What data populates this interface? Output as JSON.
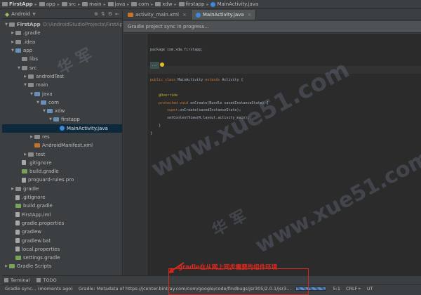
{
  "breadcrumbs": [
    {
      "label": "FirstApp",
      "bold": true,
      "icon": "folder-icon"
    },
    {
      "label": "app",
      "icon": "folder-icon"
    },
    {
      "label": "src",
      "icon": "folder-icon"
    },
    {
      "label": "main",
      "icon": "folder-icon"
    },
    {
      "label": "java",
      "icon": "folder-icon"
    },
    {
      "label": "com",
      "icon": "folder-icon"
    },
    {
      "label": "xdw",
      "icon": "folder-icon"
    },
    {
      "label": "firstapp",
      "icon": "folder-icon"
    },
    {
      "label": "MainActivity.java",
      "icon": "java-class-icon"
    }
  ],
  "project_panel": {
    "view_mode": "Android",
    "tree": [
      {
        "label": "FirstApp",
        "path": "D:\\AndroidStudioProjects\\FirstApp",
        "depth": 0,
        "icon": "folder-icon",
        "expanded": true,
        "bold": true
      },
      {
        "label": ".gradle",
        "depth": 1,
        "icon": "folder-icon",
        "expanded": false
      },
      {
        "label": ".idea",
        "depth": 1,
        "icon": "folder-icon",
        "expanded": false
      },
      {
        "label": "app",
        "depth": 1,
        "icon": "module-folder-icon",
        "expanded": true
      },
      {
        "label": "libs",
        "depth": 2,
        "icon": "folder-icon"
      },
      {
        "label": "src",
        "depth": 2,
        "icon": "folder-icon",
        "expanded": true
      },
      {
        "label": "androidTest",
        "depth": 3,
        "icon": "folder-icon",
        "expanded": false
      },
      {
        "label": "main",
        "depth": 3,
        "icon": "folder-icon",
        "expanded": true
      },
      {
        "label": "java",
        "depth": 4,
        "icon": "source-folder-icon",
        "expanded": true
      },
      {
        "label": "com",
        "depth": 5,
        "icon": "package-icon",
        "expanded": true
      },
      {
        "label": "xdw",
        "depth": 6,
        "icon": "package-icon",
        "expanded": true
      },
      {
        "label": "firstapp",
        "depth": 7,
        "icon": "package-icon",
        "expanded": true
      },
      {
        "label": "MainActivity.java",
        "depth": 8,
        "icon": "java-class-icon",
        "selected": true
      },
      {
        "label": "res",
        "depth": 4,
        "icon": "folder-icon",
        "expanded": false
      },
      {
        "label": "AndroidManifest.xml",
        "depth": 4,
        "icon": "xml-file-icon"
      },
      {
        "label": "test",
        "depth": 3,
        "icon": "folder-icon",
        "expanded": false
      },
      {
        "label": ".gitignore",
        "depth": 2,
        "icon": "text-file-icon"
      },
      {
        "label": "build.gradle",
        "depth": 2,
        "icon": "gradle-file-icon"
      },
      {
        "label": "proguard-rules.pro",
        "depth": 2,
        "icon": "text-file-icon"
      },
      {
        "label": "gradle",
        "depth": 1,
        "icon": "folder-icon",
        "expanded": false
      },
      {
        "label": ".gitignore",
        "depth": 1,
        "icon": "text-file-icon"
      },
      {
        "label": "build.gradle",
        "depth": 1,
        "icon": "gradle-file-icon"
      },
      {
        "label": "FirstApp.iml",
        "depth": 1,
        "icon": "iml-file-icon"
      },
      {
        "label": "gradle.properties",
        "depth": 1,
        "icon": "properties-file-icon"
      },
      {
        "label": "gradlew",
        "depth": 1,
        "icon": "text-file-icon"
      },
      {
        "label": "gradlew.bat",
        "depth": 1,
        "icon": "text-file-icon"
      },
      {
        "label": "local.properties",
        "depth": 1,
        "icon": "properties-file-icon"
      },
      {
        "label": "settings.gradle",
        "depth": 1,
        "icon": "gradle-file-icon"
      },
      {
        "label": "Gradle Scripts",
        "depth": 0,
        "icon": "gradle-scripts-icon",
        "expanded": false
      }
    ]
  },
  "editor_tabs": [
    {
      "label": "activity_main.xml",
      "icon": "xml-file-icon",
      "active": false,
      "close": "×"
    },
    {
      "label": "MainActivity.java",
      "icon": "java-class-icon",
      "active": true,
      "close": "×"
    }
  ],
  "banner": {
    "text": "Gradle project sync in progress..."
  },
  "code": {
    "line1": "package com.xdw.firstapp;",
    "import_fold": "...",
    "class_line_kw": "public class",
    "class_name": " MainActivity ",
    "class_extends": "extends",
    "class_rest": " Activity {",
    "override": "@Override",
    "oncreate_kw": "protected void",
    "oncreate_rest": " onCreate(Bundle savedInstanceState) {",
    "super_kw": "super",
    "super_rest": ".onCreate(savedInstanceState);",
    "setcontent": "setContentView(R.layout.activity_main);",
    "close_inner": "}",
    "close_outer": "}"
  },
  "bottom_tools": [
    {
      "label": "Terminal",
      "icon": "terminal-icon"
    },
    {
      "label": "TODO",
      "icon": "todo-icon"
    }
  ],
  "status": {
    "message": "Gradle sync... (moments ago)",
    "gradle_text": "Gradle: Metadata of https://jcenter.bintray.com/com/google/code/findbugs/jsr305/2.0.1/jsr3...",
    "progress": 0.5,
    "position": "5:1",
    "line_sep": "CRLF÷",
    "encoding": "UT"
  },
  "annotation": {
    "text": "gradle在从网上同步需要的组件环境",
    "color": "#e0281e"
  },
  "watermarks": [
    "华 军",
    "www.xue51.com",
    "华 军"
  ],
  "colors": {
    "selection": "#0d293e",
    "editor_bg": "#2b2b2b",
    "panel_bg": "#3c3f41",
    "keyword": "#cc7832",
    "annotation": "#bbb529"
  }
}
